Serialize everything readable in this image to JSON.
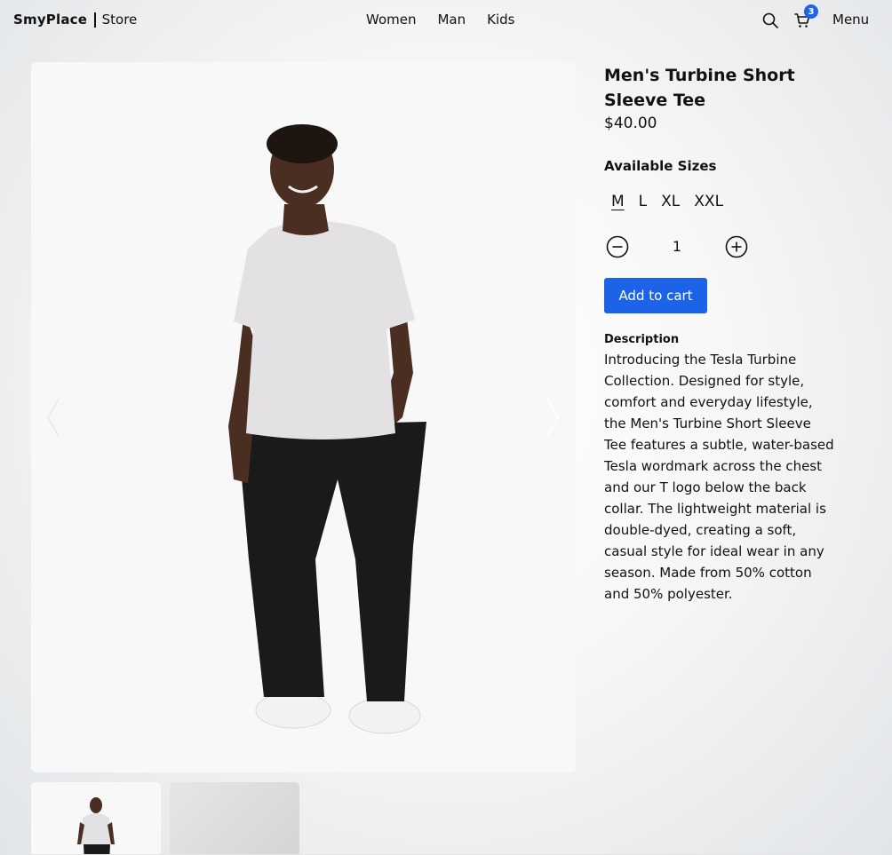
{
  "header": {
    "brand": "SmyPlace",
    "brand_suffix": "Store",
    "nav": [
      "Women",
      "Man",
      "Kids"
    ],
    "cart_count": "3",
    "menu_label": "Menu",
    "icons": {
      "search": "search-icon",
      "cart": "cart-icon"
    }
  },
  "gallery": {
    "icons": {
      "prev": "chevron-left-icon",
      "next": "chevron-right-icon"
    }
  },
  "product": {
    "title": "Men's Turbine Short Sleeve Tee",
    "price": "$40.00",
    "sizes_label": "Available Sizes",
    "sizes": [
      "M",
      "L",
      "XL",
      "XXL"
    ],
    "selected_size": "M",
    "quantity": "1",
    "add_to_cart_label": "Add to cart",
    "description_label": "Description",
    "description": "Introducing the Tesla Turbine Collection. Designed for style, comfort and everyday lifestyle, the Men's Turbine Short Sleeve Tee features a subtle, water-based Tesla wordmark across the chest and our T logo below the back collar. The lightweight material is double-dyed, creating a soft, casual style for ideal wear in any season. Made from 50% cotton and 50% polyester."
  },
  "colors": {
    "accent": "#1d63e8",
    "text": "#111111",
    "image_bg": "#f9f8f8"
  }
}
